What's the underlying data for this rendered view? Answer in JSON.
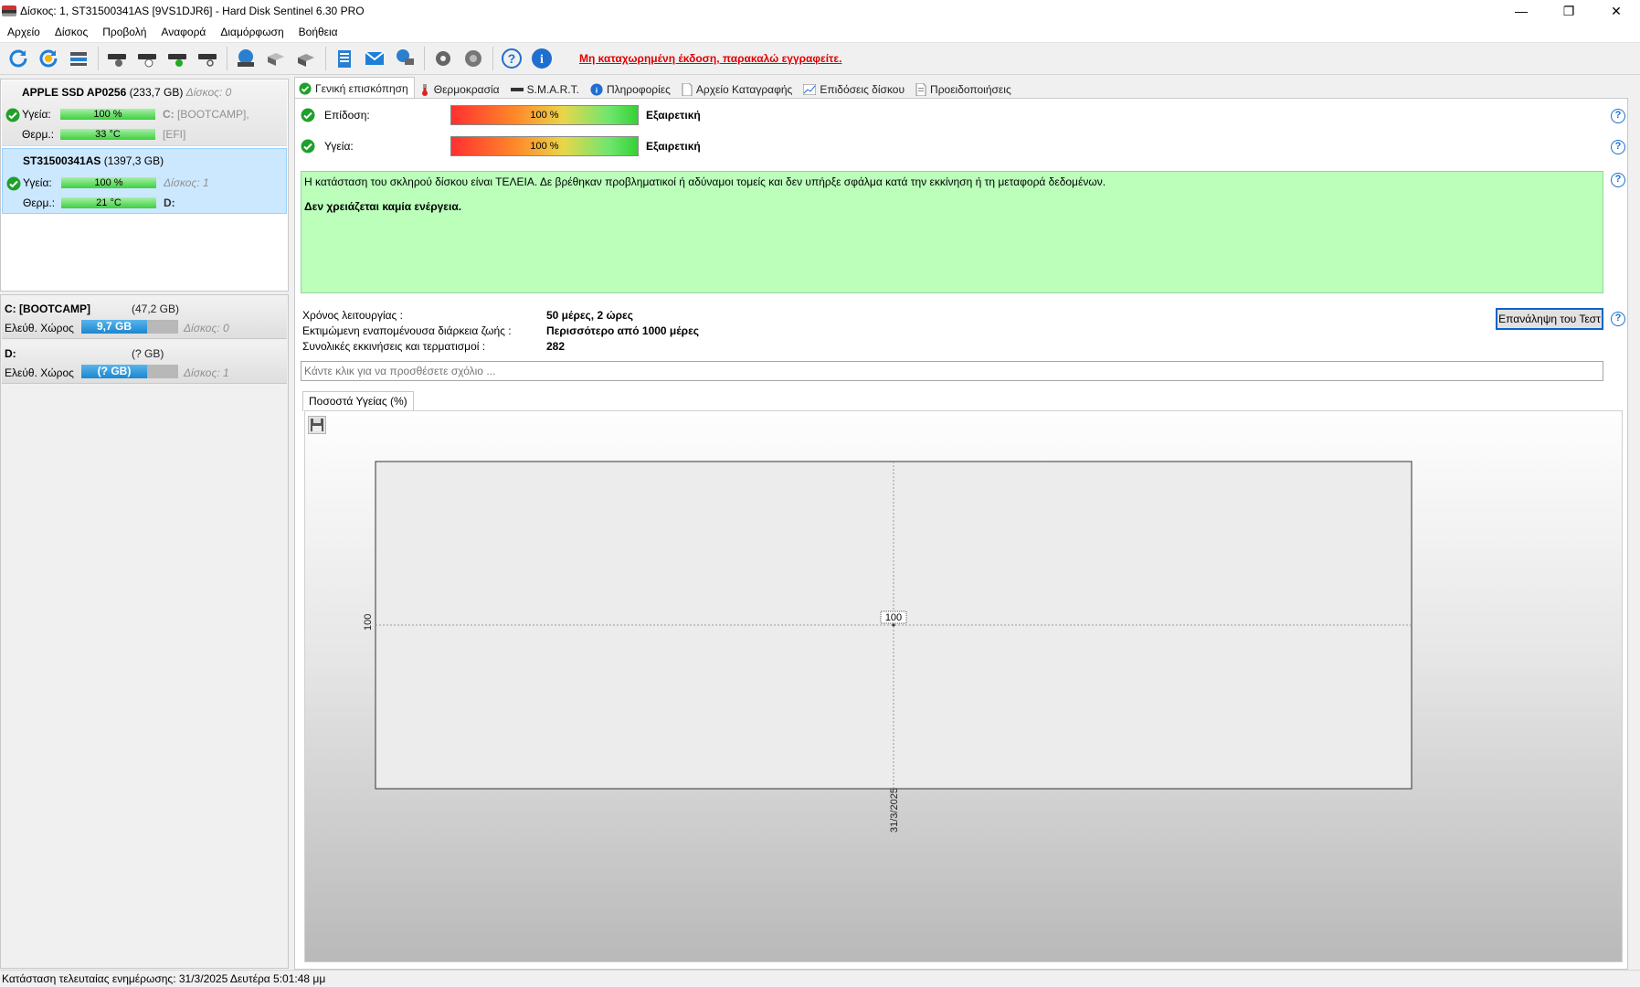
{
  "window": {
    "title": "Δίσκος: 1, ST31500341AS [9VS1DJR6]  -  Hard Disk Sentinel 6.30 PRO",
    "controls": {
      "minimize": "—",
      "maximize": "❐",
      "close": "✕"
    }
  },
  "menu": [
    "Αρχείο",
    "Δίσκος",
    "Προβολή",
    "Αναφορά",
    "Διαμόρφωση",
    "Βοήθεια"
  ],
  "toolbar": {
    "unregistered_text": "Μη καταχωρημένη έκδοση, παρακαλώ εγγραφείτε."
  },
  "disks": [
    {
      "model": "APPLE SSD AP0256",
      "capacity": "(233,7 GB)",
      "index_label": "Δίσκος: 0",
      "health_label": "Υγεία:",
      "health_value": "100 %",
      "health_fraction": 1.0,
      "temp_label": "Θερμ.:",
      "temp_value": "33 °C",
      "part1_letter": "C:",
      "part1_name": "[BOOTCAMP],",
      "part2_name": "[EFI]"
    },
    {
      "model": "ST31500341AS",
      "capacity": "(1397,3 GB)",
      "health_label": "Υγεία:",
      "health_value": "100 %",
      "health_fraction": 1.0,
      "disk_index": "Δίσκος: 1",
      "temp_label": "Θερμ.:",
      "temp_value": "21 °C",
      "part_letter": "D:"
    }
  ],
  "partitions": [
    {
      "name": "C: [BOOTCAMP]",
      "size": "(47,2 GB)",
      "free_label": "Ελεύθ. Χώρος",
      "free_value": "9,7 GB",
      "free_fraction": 0.68,
      "disk": "Δίσκος: 0"
    },
    {
      "name": "D:",
      "size": "(? GB)",
      "free_label": "Ελεύθ. Χώρος",
      "free_value": "(? GB)",
      "free_fraction": 0.68,
      "disk": "Δίσκος: 1"
    }
  ],
  "tabs": [
    {
      "label": "Γενική επισκόπηση",
      "icon": "check-icon",
      "active": true
    },
    {
      "label": "Θερμοκρασία",
      "icon": "thermometer-icon",
      "active": false
    },
    {
      "label": "S.M.A.R.T.",
      "icon": "drive-icon",
      "active": false
    },
    {
      "label": "Πληροφορίες",
      "icon": "info-icon",
      "active": false
    },
    {
      "label": "Αρχείο Καταγραφής",
      "icon": "document-icon",
      "active": false
    },
    {
      "label": "Επιδόσεις δίσκου",
      "icon": "chart-icon",
      "active": false
    },
    {
      "label": "Προειδοποιήσεις",
      "icon": "warning-doc-icon",
      "active": false
    }
  ],
  "overview": {
    "performance_label": "Επίδοση:",
    "performance_value": "100 %",
    "performance_rating": "Εξαιρετική",
    "health_label": "Υγεία:",
    "health_value": "100 %",
    "health_rating": "Εξαιρετική",
    "status_text": "Η κατάσταση του σκληρού δίσκου είναι ΤΕΛΕΙΑ. Δε βρέθηκαν προβληματικοί ή αδύναμοι τομείς και δεν υπήρξε σφάλμα κατά την εκκίνηση ή τη μεταφορά δεδομένων.",
    "action_text": "Δεν χρειάζεται καμία ενέργεια.",
    "uptime_label": "Χρόνος λειτουργίας :",
    "uptime_value": "50 μέρες, 2 ώρες",
    "lifetime_label": "Εκτιμώμενη εναπομένουσα διάρκεια ζωής :",
    "lifetime_value": "Περισσότερο από 1000 μέρες",
    "starts_label": "Συνολικές εκκινήσεις και τερματισμοί :",
    "starts_value": "282",
    "retest_button": "Επανάληψη του Τεστ",
    "comment_placeholder": "Κάντε κλικ για να προσθέσετε σχόλιο ...",
    "chart_tab": "Ποσοστά Υγείας (%)"
  },
  "chart_data": {
    "type": "line",
    "x": [
      "31/3/2025"
    ],
    "series": [
      {
        "values": [
          100
        ]
      }
    ],
    "ytick_labels": [
      "100"
    ],
    "point_labels": [
      "100"
    ],
    "grid": true
  },
  "statusbar": {
    "text": "Κατάσταση τελευταίας ενημέρωσης: 31/3/2025 Δευτέρα 5:01:48 μμ"
  }
}
